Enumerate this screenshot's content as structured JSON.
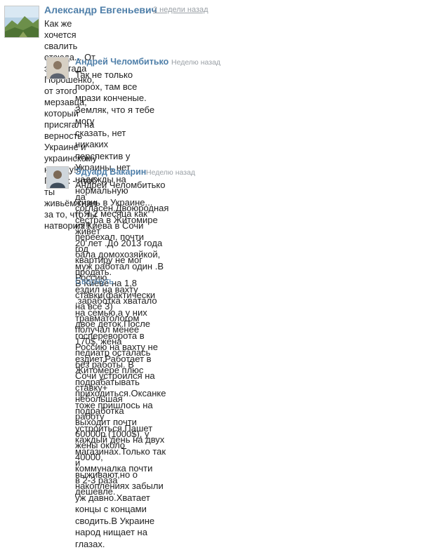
{
  "comments": [
    {
      "author": "Александр Евгеньевич",
      "time": "2 недели назад",
      "avatar_icon": "landscape-avatar-icon",
      "lines": [
        "Как же хочется свалить отсюда... От этого гада Порошенко, от этого мерзавца,",
        "который присягал на верность Украине и украинскому народу!!! Порох - чтоб ты",
        "живьём гнил за то, что ты натворил!!!"
      ]
    },
    {
      "author": "Андрей Челомбитько",
      "time": "Неделю назад",
      "avatar_icon": "person-avatar-icon",
      "lines": [
        "Так не только порох, там все мрази конченые. Земляк, что я тебе могу",
        "сказать, нет никаких перспектив у Украины, нет надежды на нормальную",
        "жизнь в Украине...(( Я 2 месяца как из Киева в Сочи переехал, почти год",
        "квартиру не мог продать.",
        "В Киеве на 1,8 ставки(фактически на все 3) травматологом получал менее",
        "170$, жена педиатр осталась без работы. В Сочи устроился на ставку+",
        "небольшая подработка выходит почти 60000р (1000$), у жены около 40000,",
        "коммуналка почти в 2-3 раза дешевле."
      ]
    },
    {
      "author": "Эдуард Вакарин",
      "time": "Неделю назад",
      "avatar_icon": "person-avatar-icon",
      "lines": [
        "Андрей Челомбитько да согласен.Двоюродная сестра в Житомире живёт",
        "20 лет .До 2013 года бала домохозяйкой, муж работал один .В Россию",
        "ездил на вахту ,заработка хватало на семью,а у них двое деток.После",
        "госпереворота в Россию на вахту не ездиет.Работает в Житомере плюс",
        "подрабатывать приходиться.Оксанке тоже пришлось на работу",
        "устроиться.Пашет каждый день на двух магазинах.Только так и",
        "выживают,но о накоплениях забыли уж давно.Хватает концы с концами",
        "сводить.В Украине народ нищает на глазах."
      ],
      "collapse_label": "Свернуть"
    }
  ]
}
